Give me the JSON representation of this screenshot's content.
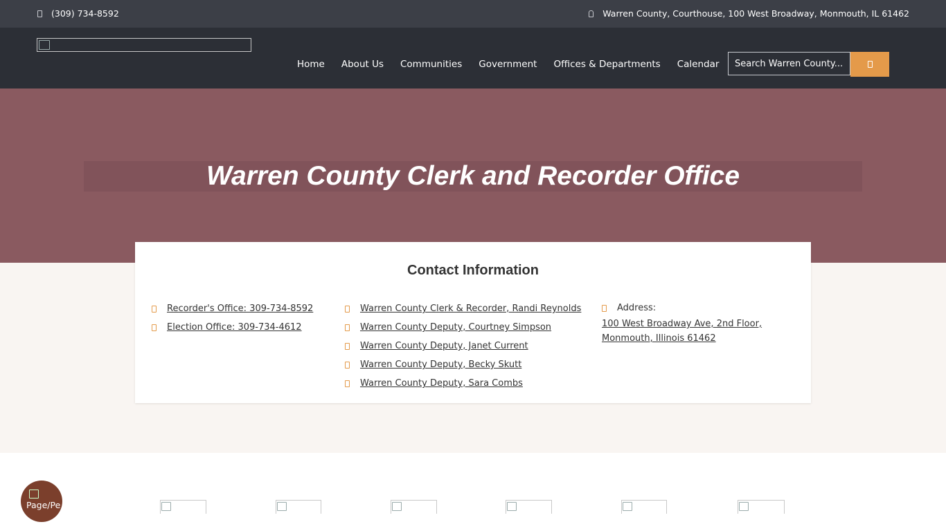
{
  "topbar": {
    "phone": "(309) 734-8592",
    "address": "Warren County, Courthouse, 100 West Broadway, Monmouth, IL 61462",
    "phone_icon": "phone-icon",
    "address_icon": "map-marker-icon"
  },
  "nav": {
    "items": [
      "Home",
      "About Us",
      "Communities",
      "Government",
      "Offices & Departments",
      "Calendar"
    ]
  },
  "search": {
    "placeholder": "Search Warren County..."
  },
  "hero": {
    "title": "Warren County Clerk and Recorder Office"
  },
  "contact": {
    "heading": "Contact Information",
    "phones": [
      "Recorder's Office: 309-734-8592",
      "Election Office: 309-734-4612"
    ],
    "people": [
      "Warren County Clerk & Recorder, Randi Reynolds",
      "Warren County Deputy, Courtney Simpson",
      "Warren County Deputy, Janet Current",
      "Warren County Deputy, Becky Skutt",
      "Warren County Deputy, Sara Combs"
    ],
    "address_label": "Address:",
    "address_lines": [
      "100 West Broadway Ave, 2nd Floor,",
      "Monmouth, Illinois 61462"
    ]
  },
  "floating_button": {
    "alt_text": "Page/Pers..."
  },
  "colors": {
    "topbar": "#3c3f47",
    "header": "#2c2f36",
    "hero": "#8a5a60",
    "accent": "#e49a4a",
    "cream": "#f9f5f2"
  }
}
